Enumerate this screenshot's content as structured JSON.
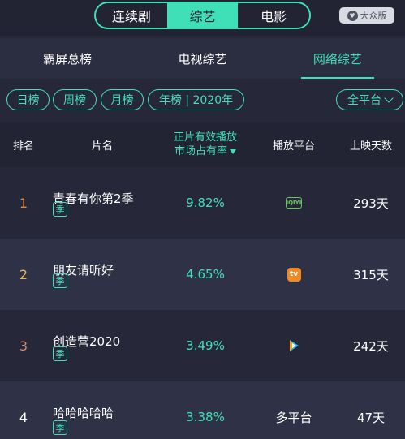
{
  "top_tabs": [
    "连续剧",
    "综艺",
    "电影"
  ],
  "version_label": "大众版",
  "sub_tabs": [
    "霸屏总榜",
    "电视综艺",
    "网络综艺"
  ],
  "filters": {
    "day": "日榜",
    "week": "周榜",
    "month": "月榜",
    "year": "年榜 | 2020年",
    "platform": "全平台"
  },
  "table": {
    "headers": {
      "rank": "排名",
      "title": "片名",
      "share_line1": "正片有效播放",
      "share_line2": "市场占有率",
      "platform": "播放平台",
      "days": "上映天数"
    },
    "rows": [
      {
        "rank": "1",
        "title": "青春有你第2季",
        "badge": "季",
        "share": "9.82%",
        "platform_icon": "iqiyi-icon",
        "platform_text": "iQIYI",
        "days": "293天",
        "rank_color": "#e08a3c"
      },
      {
        "rank": "2",
        "title": "朋友请听好",
        "badge": "季",
        "share": "4.65%",
        "platform_icon": "youku-icon",
        "platform_text": "",
        "days": "315天",
        "rank_color": "#e8b34a"
      },
      {
        "rank": "3",
        "title": "创造营2020",
        "badge": "季",
        "share": "3.49%",
        "platform_icon": "tencent-video-icon",
        "platform_text": "",
        "days": "242天",
        "rank_color": "#c98a6e"
      },
      {
        "rank": "4",
        "title": "哈哈哈哈哈",
        "badge": "季",
        "share": "3.38%",
        "platform_icon": "",
        "platform_text": "多平台",
        "days": "47天",
        "rank_color": "#ffffff"
      }
    ]
  },
  "colors": {
    "accent": "#3fe0b8",
    "background": "#26283a",
    "row_alt": "#2f3246"
  }
}
